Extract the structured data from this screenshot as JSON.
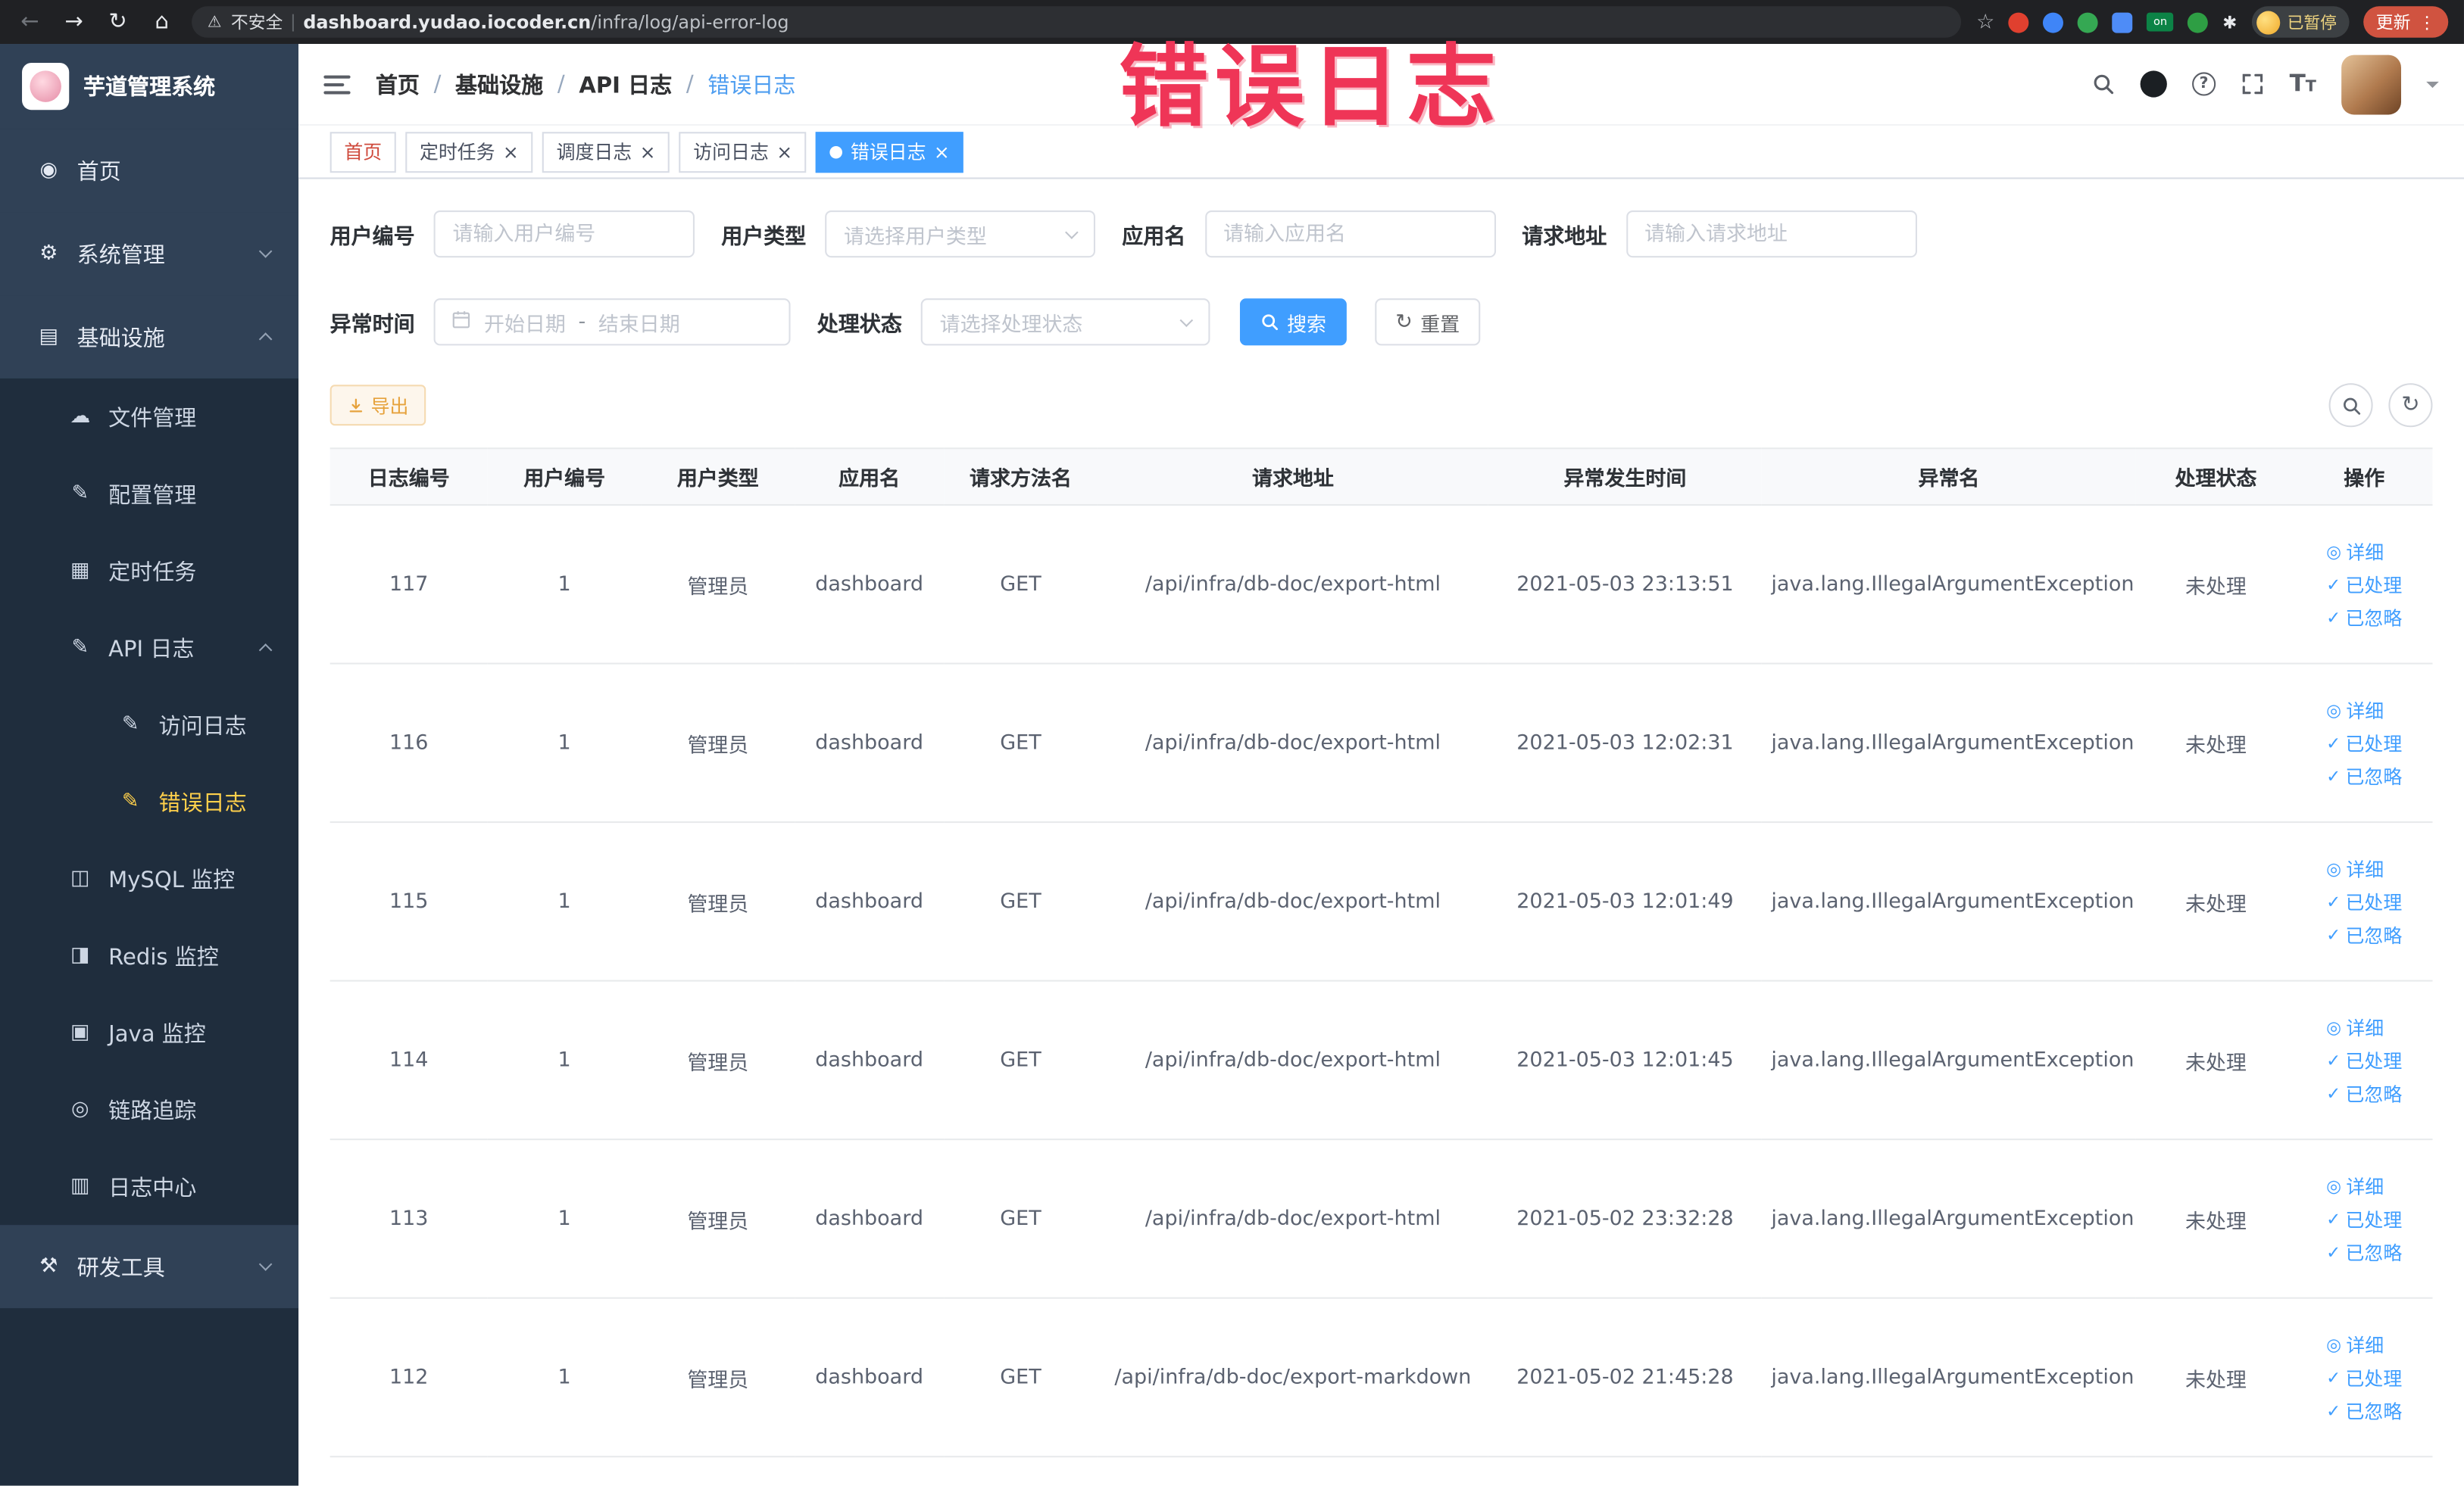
{
  "annotation": {
    "text": "错误日志"
  },
  "browser": {
    "security_label": "不安全",
    "url_domain": "dashboard.yudao.iocoder.cn",
    "url_path": "/infra/log/api-error-log",
    "profile_badge": "已暂停",
    "update_label": "更新"
  },
  "icons": {
    "back": "←",
    "forward": "→",
    "reload": "↻",
    "home": "⌂",
    "warning": "⚠",
    "star": "☆",
    "pinwheel": "✱",
    "menu_dots": "⋮",
    "ext_on": "on",
    "gauge": "◉",
    "gear": "⚙",
    "infra": "▤",
    "cloud": "☁",
    "edit": "✎",
    "list": "▦",
    "mysql": "◫",
    "redis": "◨",
    "java": "▣",
    "eye": "◎",
    "doc": "▥",
    "tools": "⚒",
    "close": "×",
    "check": "✓",
    "view": "◎",
    "question": "?",
    "font_size": "T"
  },
  "sidebar": {
    "title": "芋道管理系统",
    "items": [
      {
        "label": "首页"
      },
      {
        "label": "系统管理"
      },
      {
        "label": "基础设施"
      },
      {
        "label": "文件管理"
      },
      {
        "label": "配置管理"
      },
      {
        "label": "定时任务"
      },
      {
        "label": "API 日志"
      },
      {
        "label": "访问日志"
      },
      {
        "label": "错误日志"
      },
      {
        "label": "MySQL 监控"
      },
      {
        "label": "Redis 监控"
      },
      {
        "label": "Java 监控"
      },
      {
        "label": "链路追踪"
      },
      {
        "label": "日志中心"
      },
      {
        "label": "研发工具"
      }
    ]
  },
  "header": {
    "breadcrumb": [
      {
        "label": "首页"
      },
      {
        "label": "基础设施"
      },
      {
        "label": "API 日志"
      },
      {
        "label": "错误日志"
      }
    ]
  },
  "tabs": [
    {
      "label": "首页"
    },
    {
      "label": "定时任务"
    },
    {
      "label": "调度日志"
    },
    {
      "label": "访问日志"
    },
    {
      "label": "错误日志"
    }
  ],
  "filters": {
    "user_id_label": "用户编号",
    "user_id_placeholder": "请输入用户编号",
    "user_type_label": "用户类型",
    "user_type_placeholder": "请选择用户类型",
    "app_name_label": "应用名",
    "app_name_placeholder": "请输入应用名",
    "request_url_label": "请求地址",
    "request_url_placeholder": "请输入请求地址",
    "exception_time_label": "异常时间",
    "date_start_placeholder": "开始日期",
    "date_separator": "-",
    "date_end_placeholder": "结束日期",
    "process_status_label": "处理状态",
    "process_status_placeholder": "请选择处理状态",
    "search_label": "搜索",
    "reset_label": "重置"
  },
  "toolbar": {
    "export_label": "导出"
  },
  "table": {
    "columns": [
      "日志编号",
      "用户编号",
      "用户类型",
      "应用名",
      "请求方法名",
      "请求地址",
      "异常发生时间",
      "异常名",
      "处理状态",
      "操作"
    ],
    "actions": {
      "detail": "详细",
      "processed": "已处理",
      "ignored": "已忽略"
    },
    "rows": [
      {
        "id": "117",
        "user_id": "1",
        "user_type": "管理员",
        "app_name": "dashboard",
        "method": "GET",
        "url": "/api/infra/db-doc/export-html",
        "time": "2021-05-03 23:13:51",
        "exception": "java.lang.IllegalArgumentException",
        "status": "未处理"
      },
      {
        "id": "116",
        "user_id": "1",
        "user_type": "管理员",
        "app_name": "dashboard",
        "method": "GET",
        "url": "/api/infra/db-doc/export-html",
        "time": "2021-05-03 12:02:31",
        "exception": "java.lang.IllegalArgumentException",
        "status": "未处理"
      },
      {
        "id": "115",
        "user_id": "1",
        "user_type": "管理员",
        "app_name": "dashboard",
        "method": "GET",
        "url": "/api/infra/db-doc/export-html",
        "time": "2021-05-03 12:01:49",
        "exception": "java.lang.IllegalArgumentException",
        "status": "未处理"
      },
      {
        "id": "114",
        "user_id": "1",
        "user_type": "管理员",
        "app_name": "dashboard",
        "method": "GET",
        "url": "/api/infra/db-doc/export-html",
        "time": "2021-05-03 12:01:45",
        "exception": "java.lang.IllegalArgumentException",
        "status": "未处理"
      },
      {
        "id": "113",
        "user_id": "1",
        "user_type": "管理员",
        "app_name": "dashboard",
        "method": "GET",
        "url": "/api/infra/db-doc/export-html",
        "time": "2021-05-02 23:32:28",
        "exception": "java.lang.IllegalArgumentException",
        "status": "未处理"
      },
      {
        "id": "112",
        "user_id": "1",
        "user_type": "管理员",
        "app_name": "dashboard",
        "method": "GET",
        "url": "/api/infra/db-doc/export-markdown",
        "time": "2021-05-02 21:45:28",
        "exception": "java.lang.IllegalArgumentException",
        "status": "未处理"
      }
    ]
  }
}
